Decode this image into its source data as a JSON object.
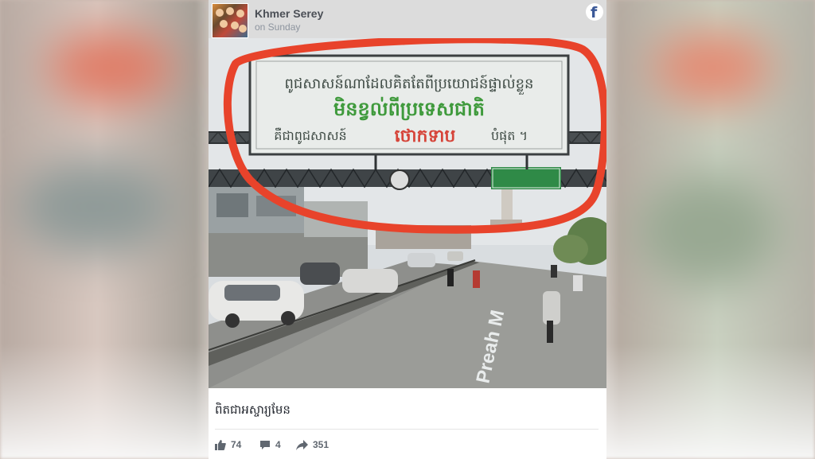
{
  "post": {
    "page_name": "Khmer Serey",
    "time": "on Sunday",
    "caption": "ពិតជាអស្ចារ្យមែន"
  },
  "image": {
    "billboard_line1": "ពូជសាសន៍ណាដែលគិតតែពីប្រយោជន៍ផ្ទាល់ខ្លួន",
    "billboard_line2": "មិនខ្វល់ពីប្រទេសជាតិ",
    "billboard_line3a": "គឺជាពូជសាសន៍",
    "billboard_line3b": "ថោកទាប",
    "billboard_line3c": "បំផុត ។",
    "road_marking": "Preah M",
    "colors": {
      "highlight_circle": "#e8432b",
      "billboard_green": "#3f9a3c",
      "billboard_red": "#d6453a",
      "road_sign_green": "#2f8a47"
    }
  },
  "engagement": {
    "likes": "74",
    "comments": "4",
    "shares": "351"
  },
  "icons": [
    "facebook-icon",
    "like-icon",
    "comment-icon",
    "share-icon"
  ]
}
